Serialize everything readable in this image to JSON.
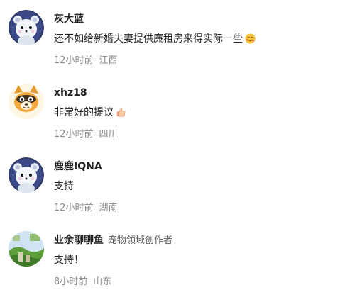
{
  "comments": [
    {
      "username": "灰大蓝",
      "creator_tag": "",
      "text": "还不如给新婚夫妻提供廉租房来得实际一些",
      "emoji": "smiling-face-with-hearts-icon",
      "time": "12小时前",
      "location": "江西",
      "avatar": "bear-avatar-icon"
    },
    {
      "username": "xhz18",
      "creator_tag": "",
      "text": "非常好的提议",
      "emoji": "thumbs-up-icon",
      "time": "12小时前",
      "location": "四川",
      "avatar": "raccoon-avatar-icon"
    },
    {
      "username": "鹿鹿IQNA",
      "creator_tag": "",
      "text": "支持",
      "emoji": "",
      "time": "12小时前",
      "location": "湖南",
      "avatar": "bear-avatar-icon"
    },
    {
      "username": "业余聊聊鱼",
      "creator_tag": "宠物领域创作者",
      "text": "支持！",
      "emoji": "",
      "time": "8小时前",
      "location": "山东",
      "avatar": "landscape-avatar-icon"
    }
  ]
}
